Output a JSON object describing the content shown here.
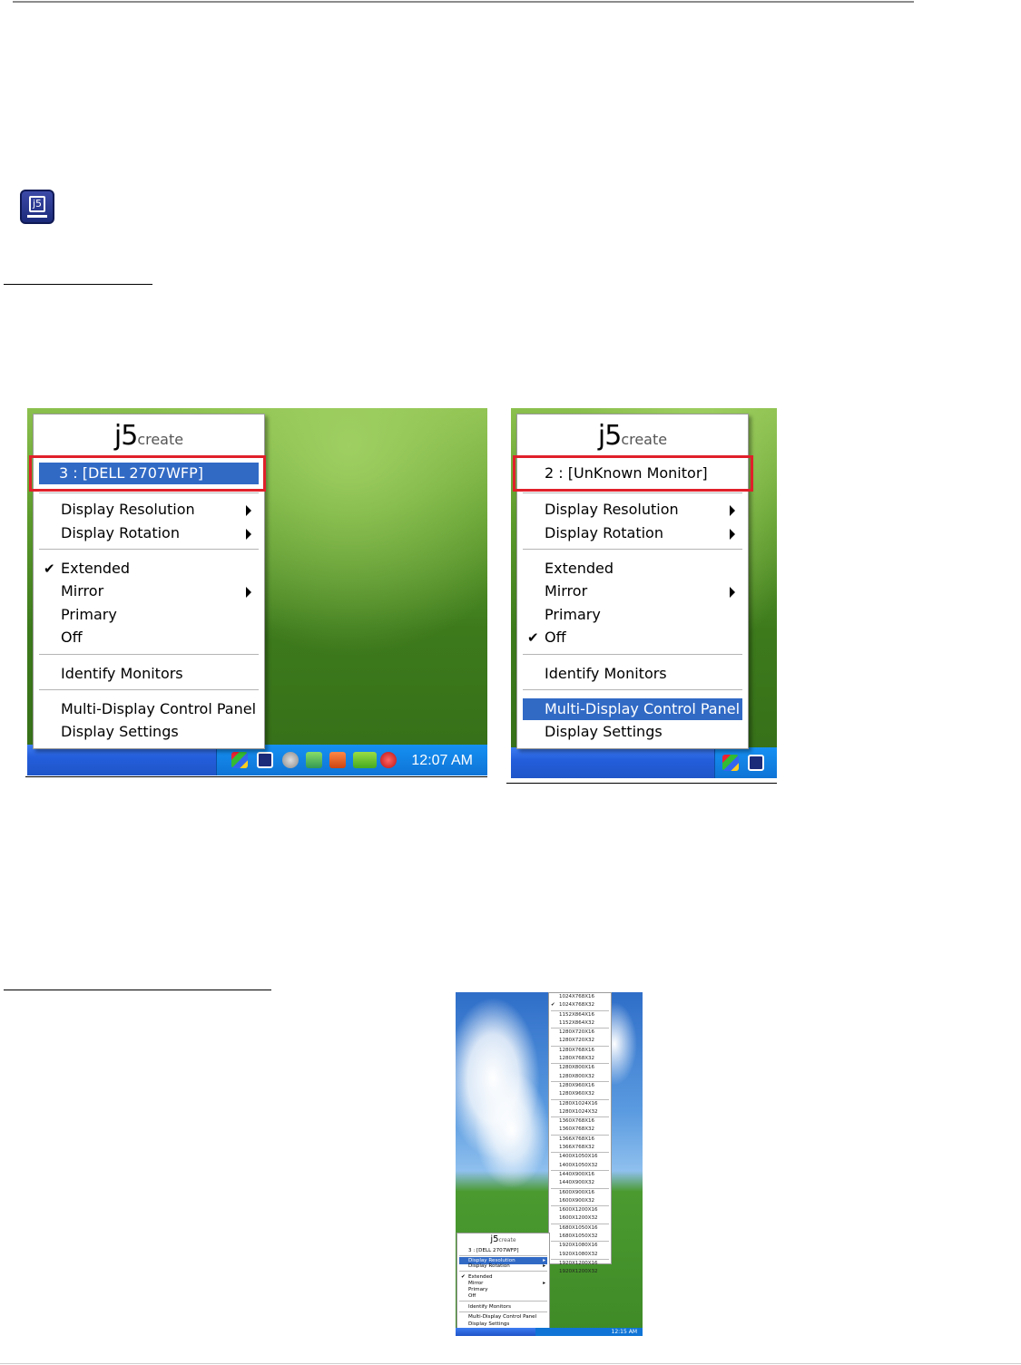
{
  "tray_icon": {
    "label": "j5"
  },
  "left_menu": {
    "brand": "j5",
    "brand_sub": "create",
    "monitor": "3 : [DELL 2707WFP]",
    "items": {
      "display_resolution": "Display Resolution",
      "display_rotation": "Display Rotation",
      "extended": "Extended",
      "mirror": "Mirror",
      "primary": "Primary",
      "off": "Off",
      "identify": "Identify Monitors",
      "control_panel": "Multi-Display Control Panel",
      "display_settings": "Display Settings"
    },
    "checked": "Extended",
    "clock": "12:07 AM"
  },
  "right_menu": {
    "brand": "j5",
    "brand_sub": "create",
    "monitor": "2 : [UnKnown Monitor]",
    "items": {
      "display_resolution": "Display Resolution",
      "display_rotation": "Display Rotation",
      "extended": "Extended",
      "mirror": "Mirror",
      "primary": "Primary",
      "off": "Off",
      "identify": "Identify Monitors",
      "control_panel": "Multi-Display Control Panel",
      "display_settings": "Display Settings"
    },
    "checked": "Off",
    "highlighted": "Multi-Display Control Panel"
  },
  "resolution_screenshot": {
    "groups": [
      [
        "1024X768X16",
        "1024X768X32"
      ],
      [
        "1152X864X16",
        "1152X864X32"
      ],
      [
        "1280X720X16",
        "1280X720X32"
      ],
      [
        "1280X768X16",
        "1280X768X32"
      ],
      [
        "1280X800X16",
        "1280X800X32"
      ],
      [
        "1280X960X16",
        "1280X960X32"
      ],
      [
        "1280X1024X16",
        "1280X1024X32"
      ],
      [
        "1360X768X16",
        "1360X768X32"
      ],
      [
        "1366X768X16",
        "1366X768X32"
      ],
      [
        "1400X1050X16",
        "1400X1050X32"
      ],
      [
        "1440X900X16",
        "1440X900X32"
      ],
      [
        "1600X900X16",
        "1600X900X32"
      ],
      [
        "1600X1200X16",
        "1600X1200X32"
      ],
      [
        "1680X1050X16",
        "1680X1050X32"
      ],
      [
        "1920X1080X16",
        "1920X1080X32"
      ],
      [
        "1920X1200X16",
        "1920X1200X32"
      ]
    ],
    "checked_resolution": "1024X768X32",
    "menu": {
      "brand": "j5",
      "brand_sub": "create",
      "monitor": "3 : [DELL 2707WFP]",
      "display_resolution": "Display Resolution",
      "display_rotation": "Display Rotation",
      "extended": "Extended",
      "mirror": "Mirror",
      "primary": "Primary",
      "off": "Off",
      "identify": "Identify Monitors",
      "control_panel": "Multi-Display Control Panel",
      "display_settings": "Display Settings"
    },
    "clock": "12:15 AM"
  }
}
